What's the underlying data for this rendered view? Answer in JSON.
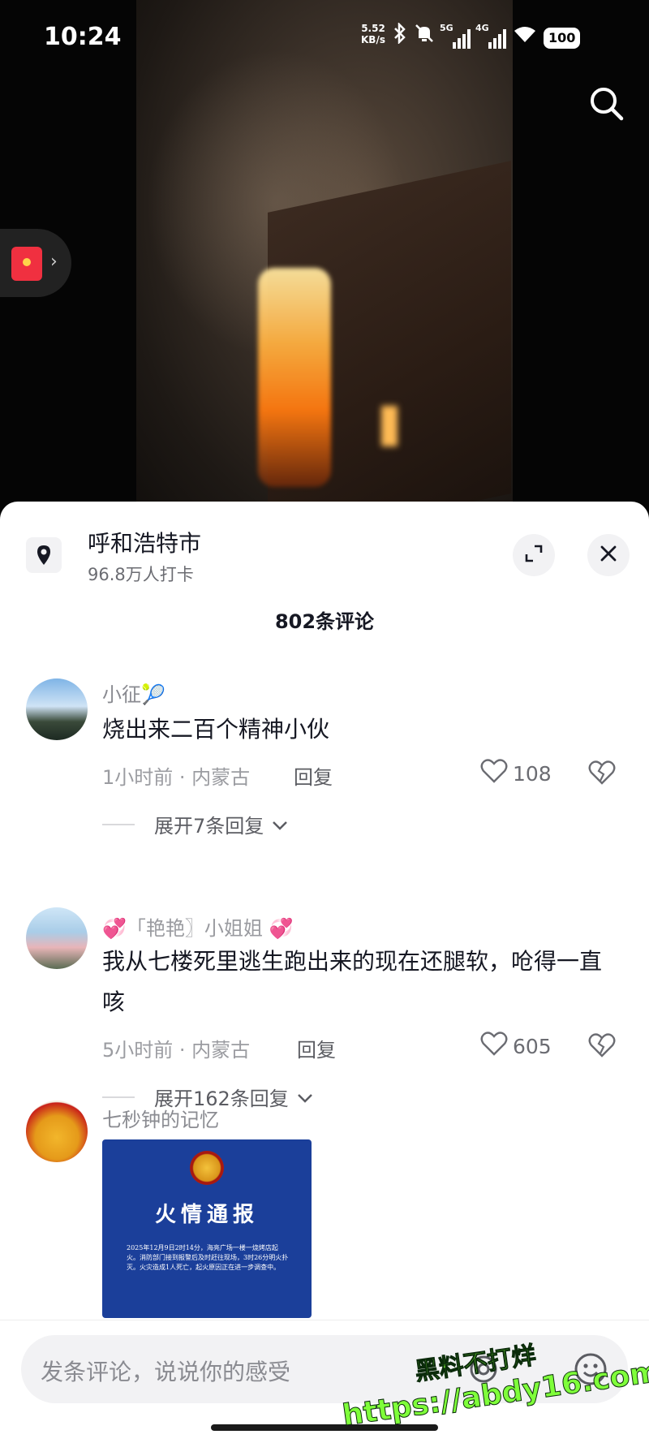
{
  "status_bar": {
    "time": "10:24",
    "net_speed_value": "5.52",
    "net_speed_unit": "KB/s",
    "signal1_label": "5G",
    "signal2_label": "4G",
    "battery": "100"
  },
  "location": {
    "name": "呼和浩特市",
    "checkins": "96.8万人打卡"
  },
  "comment_count": "802条评论",
  "comments": [
    {
      "user": "小征🎾",
      "text": "烧出来二百个精神小伙",
      "time": "1小时前",
      "region": "内蒙古",
      "reply_label": "回复",
      "likes": "108",
      "expand_label": "展开7条回复"
    },
    {
      "user": "💞「艳艳〗小姐姐 💞",
      "text": "我从七楼死里逃生跑出来的现在还腿软，呛得一直咳",
      "time": "5小时前",
      "region": "内蒙古",
      "reply_label": "回复",
      "likes": "605",
      "expand_label": "展开162条回复"
    },
    {
      "user": "七秒钟的记忆",
      "image": {
        "title": "火情通报",
        "body": "2025年12月9日2时14分，海亮广场一楼一烧烤店起火。消防部门接到报警后及时赶往现场，3时26分明火扑灭。火灾造成1人死亡，起火原因正在进一步调查中。"
      }
    }
  ],
  "input": {
    "placeholder": "发条评论，说说你的感受"
  },
  "watermark": {
    "line1": "黑料不打烊",
    "line2": "https://abdy16.com"
  },
  "colors": {
    "fire": "#ff9a2a",
    "notice_bg": "#1b3f9a",
    "red_packet": "#f03040",
    "watermark": "#7fff3a"
  }
}
